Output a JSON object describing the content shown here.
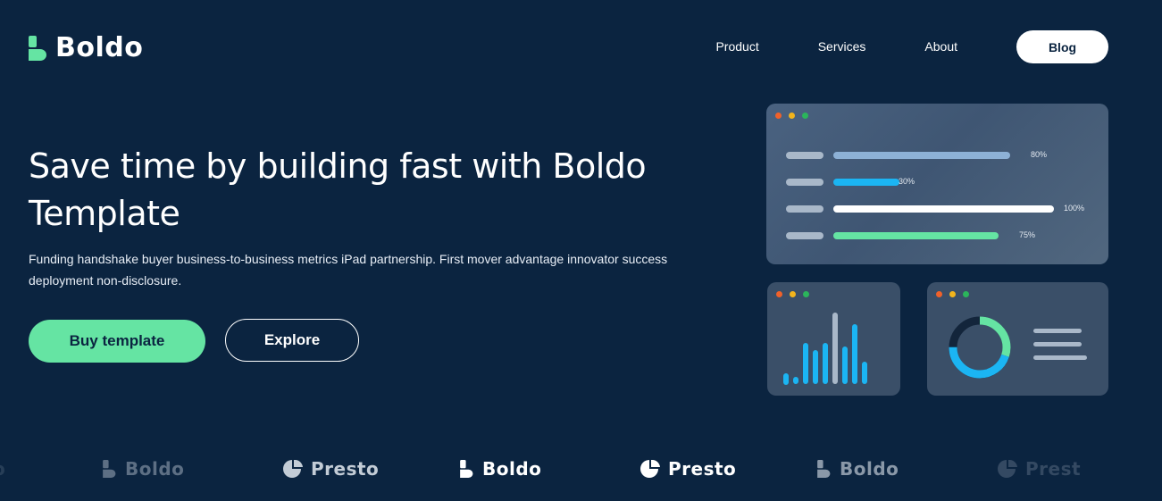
{
  "brand": {
    "name": "Boldo",
    "accent": "#65e4a3",
    "background": "#0b2440"
  },
  "nav": {
    "links": [
      "Product",
      "Services",
      "About"
    ],
    "cta": "Blog"
  },
  "hero": {
    "title": "Save time by building fast with Boldo Template",
    "description": "Funding handshake buyer business-to-business metrics iPad partnership. First mover advantage innovator success deployment non-disclosure.",
    "primary_button": "Buy template",
    "secondary_button": "Explore"
  },
  "dashboard": {
    "window_dots": [
      "#f0612a",
      "#f2b41c",
      "#2bb55b"
    ],
    "progress_rows": [
      {
        "percent": "80%",
        "value": 0.8,
        "color": "#8db1d6"
      },
      {
        "percent": "30%",
        "value": 0.3,
        "color": "#1bb5f3"
      },
      {
        "percent": "100%",
        "value": 1.0,
        "color": "#ffffff"
      },
      {
        "percent": "75%",
        "value": 0.75,
        "color": "#65e4a3"
      }
    ],
    "bar_chart": {
      "values": [
        0.15,
        0.1,
        0.55,
        0.45,
        0.55,
        0.95,
        0.5,
        0.8,
        0.3
      ],
      "colors": [
        "#1bb5f3",
        "#1bb5f3",
        "#1bb5f3",
        "#1bb5f3",
        "#1bb5f3",
        "#a9b8c9",
        "#1bb5f3",
        "#1bb5f3",
        "#1bb5f3"
      ]
    },
    "donut": {
      "green_fraction": 0.3,
      "blue_fraction": 0.45,
      "colors": [
        "#65e4a3",
        "#1bb5f3",
        "#13253b"
      ]
    }
  },
  "logo_strip": [
    {
      "name": "o",
      "icon": "presto-pie-icon",
      "opacity": 0.35,
      "color": "#5d6f84"
    },
    {
      "name": "Boldo",
      "icon": "boldo-mark-icon",
      "opacity": 1,
      "color": "#5d6f84"
    },
    {
      "name": "Presto",
      "icon": "presto-pie-icon",
      "opacity": 1,
      "color": "#c3ccd6"
    },
    {
      "name": "Boldo",
      "icon": "boldo-mark-icon",
      "opacity": 1,
      "color": "#ffffff"
    },
    {
      "name": "Presto",
      "icon": "presto-pie-icon",
      "opacity": 1,
      "color": "#ffffff"
    },
    {
      "name": "Boldo",
      "icon": "boldo-mark-icon",
      "opacity": 1,
      "color": "#8a98a8"
    },
    {
      "name": "Prest",
      "icon": "presto-pie-icon",
      "opacity": 0.5,
      "color": "#5d6f84"
    }
  ]
}
